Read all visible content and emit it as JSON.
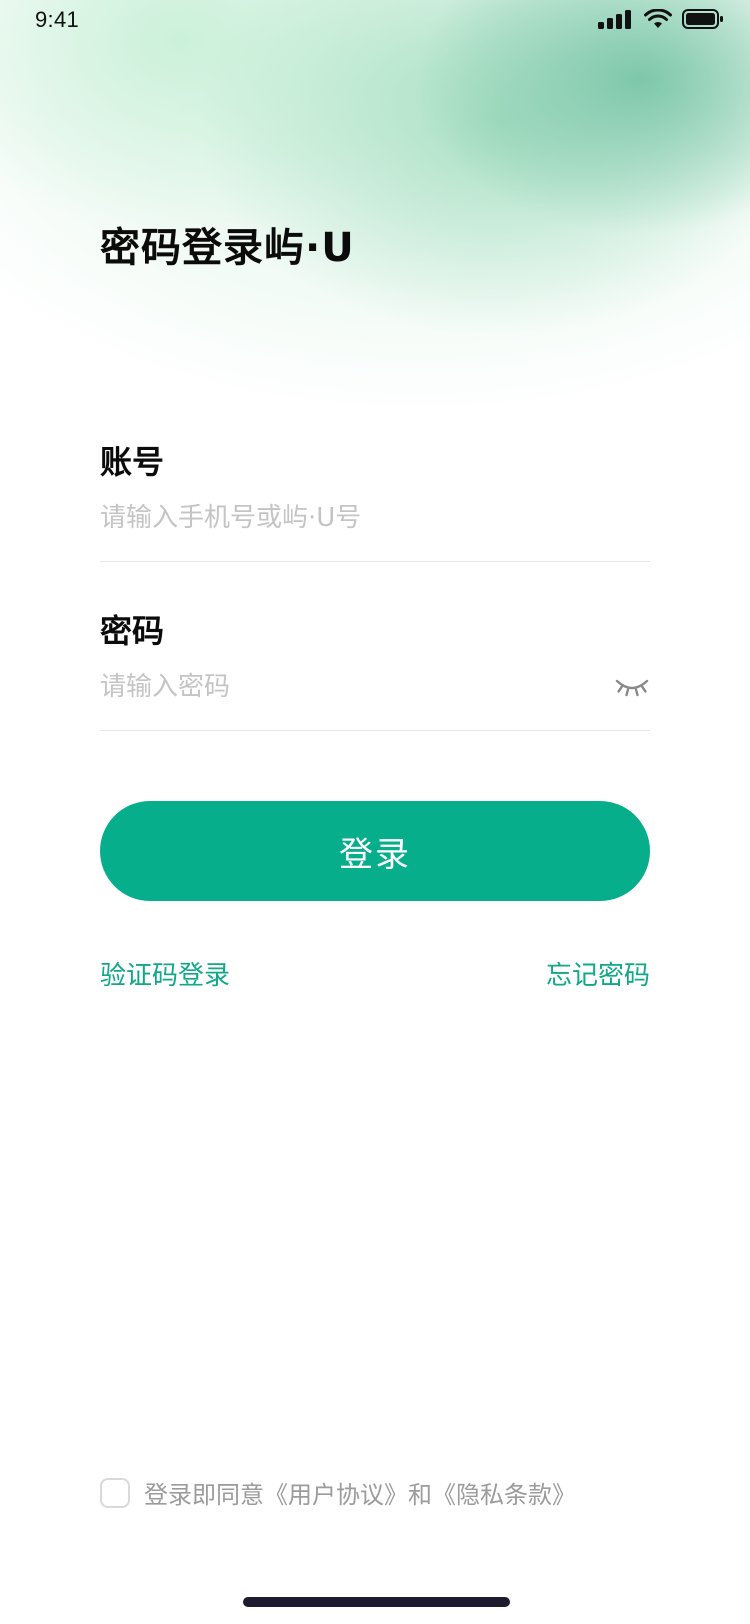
{
  "status_bar": {
    "time": "9:41"
  },
  "page": {
    "title": "密码登录屿·U"
  },
  "account_field": {
    "label": "账号",
    "value": "",
    "placeholder": "请输入手机号或屿·U号"
  },
  "password_field": {
    "label": "密码",
    "value": "",
    "placeholder": "请输入密码",
    "visibility_icon": "eye-closed-icon"
  },
  "login_button": {
    "label": "登录"
  },
  "links": {
    "sms_login": "验证码登录",
    "forgot_password": "忘记密码"
  },
  "agreement": {
    "checked": false,
    "text": "登录即同意《用户协议》和《隐私条款》"
  },
  "colors": {
    "accent": "#07AE8C",
    "link": "#10A886",
    "placeholder": "#C4C4C4",
    "glow_green": "#7AC5A8"
  }
}
